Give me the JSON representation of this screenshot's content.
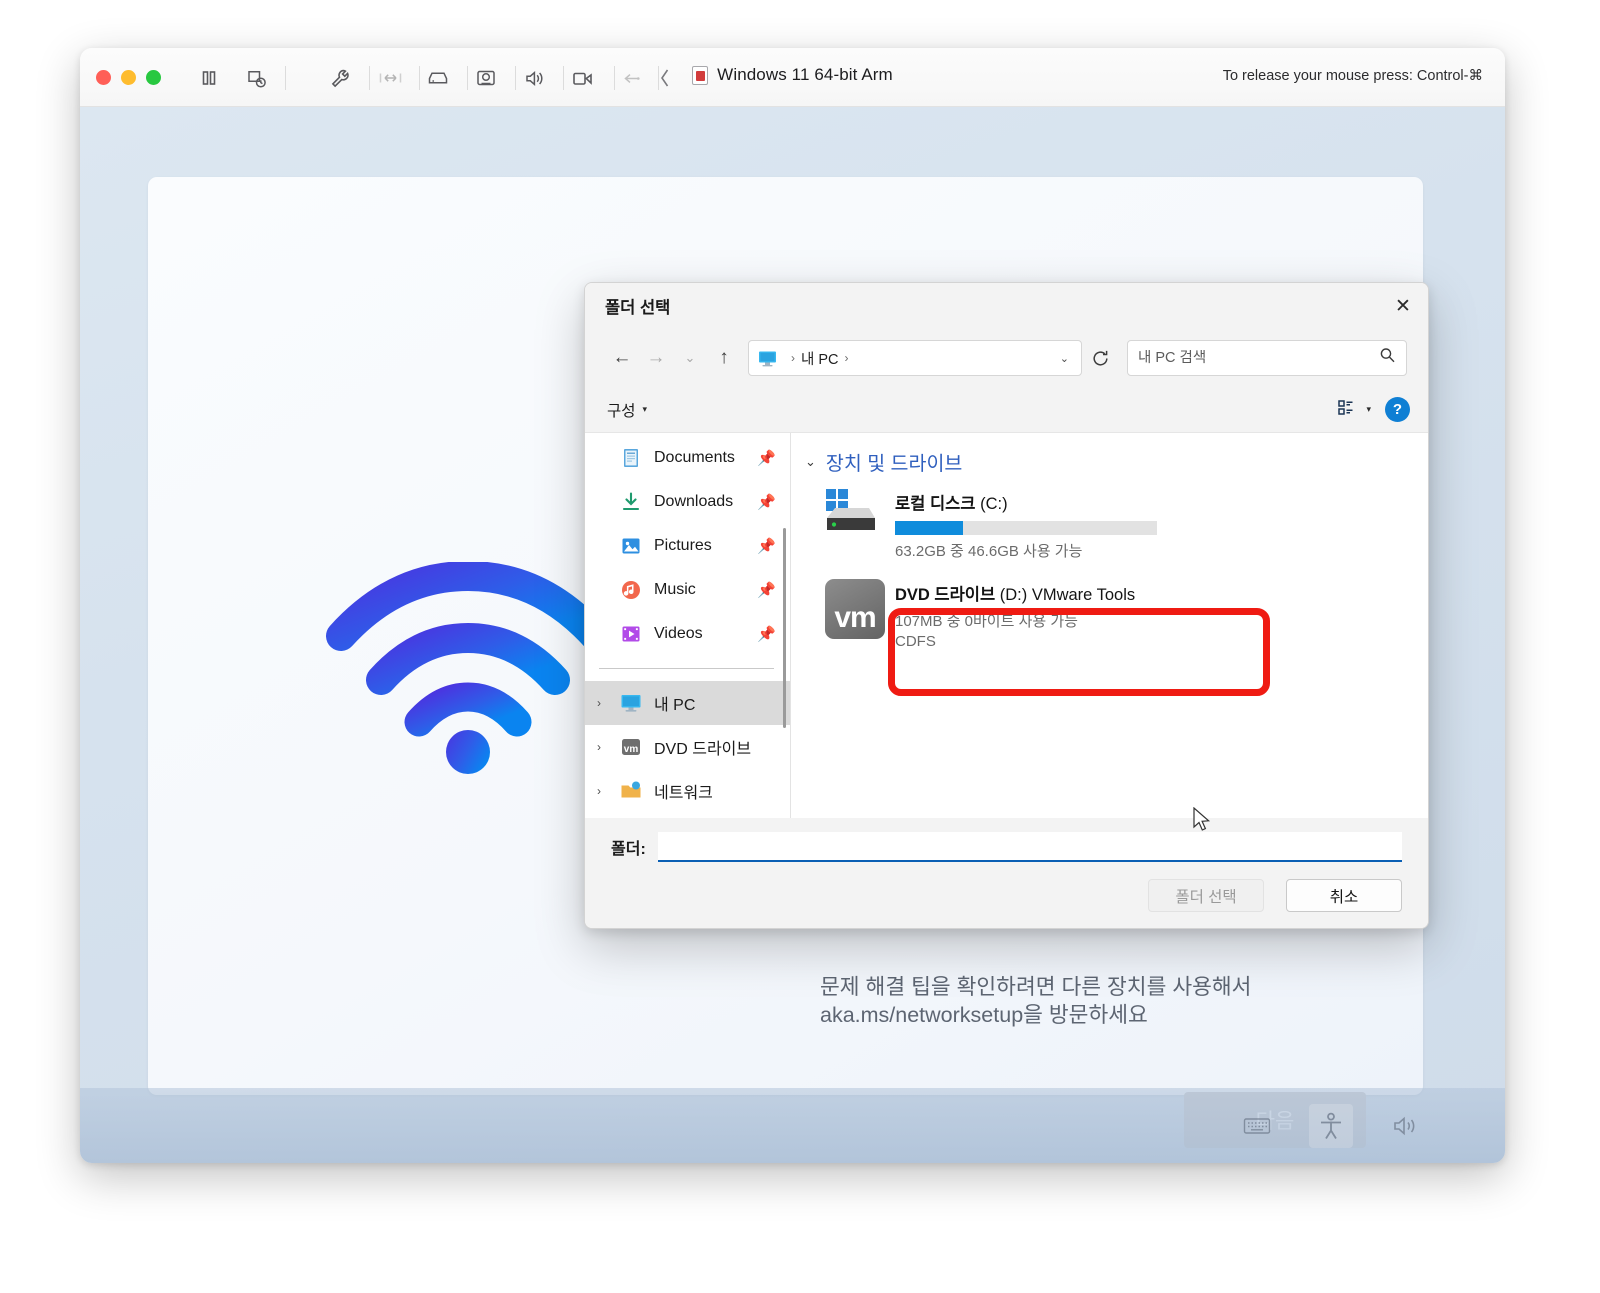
{
  "mac_window": {
    "title": "Windows 11 64-bit Arm",
    "release_hint": "To release your mouse press: Control-⌘",
    "toolbar_icons": [
      "pause-icon",
      "screenshot-clock-icon",
      "wrench-icon",
      "network-icon",
      "hard-disk-icon",
      "camera-icon",
      "speaker-icon",
      "video-camera-icon",
      "usb-icon",
      "collapse-icon"
    ]
  },
  "dialog": {
    "title": "폴더 선택",
    "close_label": "✕",
    "nav": {
      "back": "←",
      "forward": "→",
      "recent": "⌄",
      "up": "↑",
      "breadcrumb_root": "내 PC",
      "breadcrumb_sep": "›",
      "dropdown": "⌄",
      "refresh": "⟳",
      "search_placeholder": "내 PC 검색",
      "search_value": "",
      "search_icon": "search-icon"
    },
    "commandbar": {
      "organize": "구성",
      "organize_caret": "▾",
      "view_icon": "view-list-icon",
      "view_caret": "▾",
      "help": "?"
    },
    "nav_pane": {
      "quick_access": [
        {
          "label": "Documents",
          "icon": "documents-icon",
          "pinned": true
        },
        {
          "label": "Downloads",
          "icon": "downloads-icon",
          "pinned": true
        },
        {
          "label": "Pictures",
          "icon": "pictures-icon",
          "pinned": true
        },
        {
          "label": "Music",
          "icon": "music-icon",
          "pinned": true
        },
        {
          "label": "Videos",
          "icon": "videos-icon",
          "pinned": true
        }
      ],
      "tree": [
        {
          "label": "내 PC",
          "icon": "this-pc-icon",
          "chevron": "›",
          "selected": true
        },
        {
          "label": "DVD 드라이브",
          "icon": "vm-disc-icon",
          "chevron": "›",
          "selected": false
        },
        {
          "label": "네트워크",
          "icon": "network-folder-icon",
          "chevron": "›",
          "selected": false
        }
      ]
    },
    "content": {
      "group_title": "장치 및 드라이브",
      "group_caret": "⌄",
      "drives": [
        {
          "name": "로컬 디스크",
          "letter": "(C:)",
          "capacity_text": "63.2GB 중 46.6GB 사용 가능",
          "used_percent": 26,
          "bar_color": "#0f8cdc",
          "icon": "windows-hard-disk-icon"
        },
        {
          "name": "DVD 드라이브",
          "letter": "(D:) VMware Tools",
          "capacity_text": "107MB 중 0바이트 사용 가능",
          "filesystem": "CDFS",
          "icon": "vm-disc-icon",
          "icon_text": "vm",
          "highlighted": true
        }
      ]
    },
    "footer": {
      "folder_label": "폴더:",
      "folder_value": "",
      "select_button": "폴더 선택",
      "cancel_button": "취소"
    }
  },
  "oobe": {
    "body_line1": "문제 해결 팁을 확인하려면 다른 장치를 사용해서",
    "body_line2": "aka.ms/networksetup을 방문하세요",
    "next_button": "다음",
    "art": "wifi-icon"
  },
  "tray": {
    "icons": [
      "keyboard-icon",
      "accessibility-icon",
      "volume-icon"
    ]
  },
  "colors": {
    "accent_blue": "#0f8cdc",
    "highlight_red": "#ef1b13",
    "group_header_blue": "#2f5fbe",
    "focus_underline": "#0a5fb4"
  }
}
